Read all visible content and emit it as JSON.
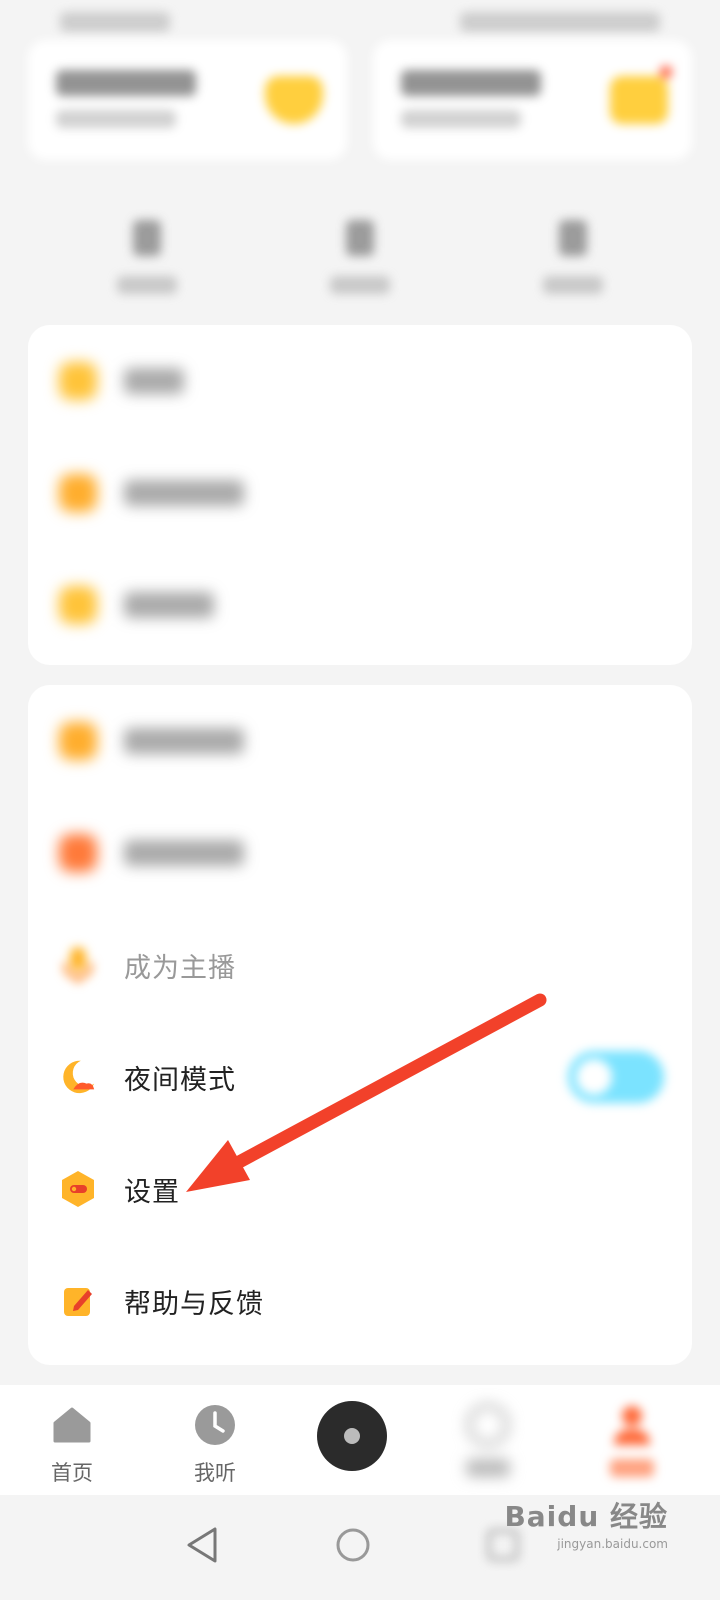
{
  "menu": {
    "become_host": "成为主播",
    "night_mode": "夜间模式",
    "night_mode_on": true,
    "settings": "设置",
    "help_feedback": "帮助与反馈"
  },
  "nav": {
    "home": "首页",
    "listening": "我听"
  },
  "colors": {
    "accent_orange": "#ffb429",
    "toggle_blue": "#7be3ff",
    "arrow_red": "#f2412a",
    "background": "#f4f4f4"
  },
  "watermark": {
    "main": "Baidu 经验",
    "sub": "jingyan.baidu.com"
  }
}
